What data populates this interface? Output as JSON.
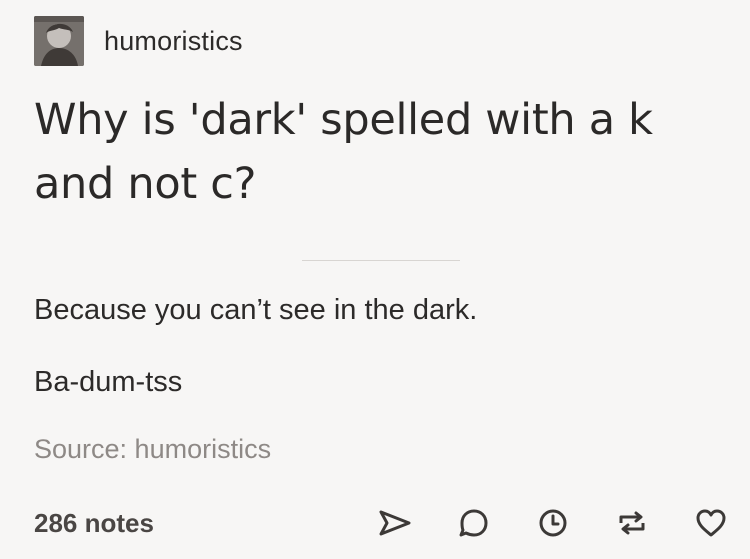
{
  "post": {
    "username": "humoristics",
    "title": "Why is 'dark' spelled with a k and not c?",
    "body": [
      "Because you can’t see in the dark.",
      "Ba-dum-tss"
    ],
    "source": "Source: humoristics",
    "notes": "286 notes"
  },
  "icons": [
    "share-icon",
    "reply-icon",
    "queue-icon",
    "reblog-icon",
    "like-icon"
  ],
  "colors": {
    "background": "#f7f6f5",
    "text": "#2c2a29",
    "muted": "#8e8986",
    "divider": "#d8d5d2"
  }
}
